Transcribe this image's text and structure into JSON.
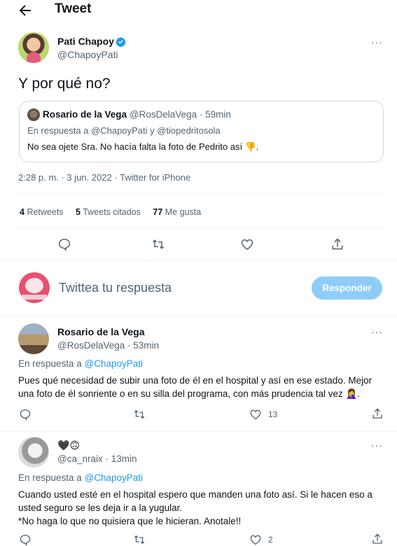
{
  "header": {
    "title": "Tweet"
  },
  "tweet": {
    "author_name": "Pati Chapoy",
    "author_handle": "@ChapoyPati",
    "more": "···",
    "text": "Y por qué no?",
    "quote": {
      "author_name": "Rosario de la Vega",
      "author_handle": "@RosDelaVega",
      "time": "· 59min",
      "reply_prefix": "En respuesta a ",
      "reply_users": "@ChapoyPati y @tiopedritosola",
      "text": "No sea ojete Sra. No hacía falta la foto de Pedrito así 👎."
    },
    "timestamp": "2:28 p. m. · 3 jun. 2022 · Twitter for iPhone",
    "stats": {
      "retweets_count": "4",
      "retweets_label": "Retweets",
      "quotes_count": "5",
      "quotes_label": "Tweets citados",
      "likes_count": "77",
      "likes_label": "Me gusta"
    }
  },
  "composer": {
    "placeholder": "Twittea tu respuesta",
    "button": "Responder"
  },
  "replies": [
    {
      "name": "Rosario de la Vega",
      "handle": "@RosDelaVega",
      "time": "· 53min",
      "reply_prefix": "En respuesta a ",
      "reply_to": "@ChapoyPati",
      "text": "Pues qué necesidad de subir una foto de él en el hospital y así en ese estado. Mejor una foto de él sonriente o en su silla del programa, con más prudencia tal vez 🤦‍♀️.",
      "likes": "13"
    },
    {
      "name": "🖤🙃",
      "handle": "@ca_nraix",
      "time": "· 13min",
      "reply_prefix": "En respuesta a ",
      "reply_to": "@ChapoyPati",
      "text_line1": "Cuando usted esté en el hospital espero que manden una foto así. Si le hacen eso a usted seguro se les deja ir a la yugular.",
      "text_line2": "*No haga lo que no quisiera que le hicieran. Anotale!!",
      "likes": "2"
    }
  ],
  "colors": {
    "accent": "#1d9bf0",
    "muted": "#536471",
    "button_disabled": "#8ecdf8"
  }
}
